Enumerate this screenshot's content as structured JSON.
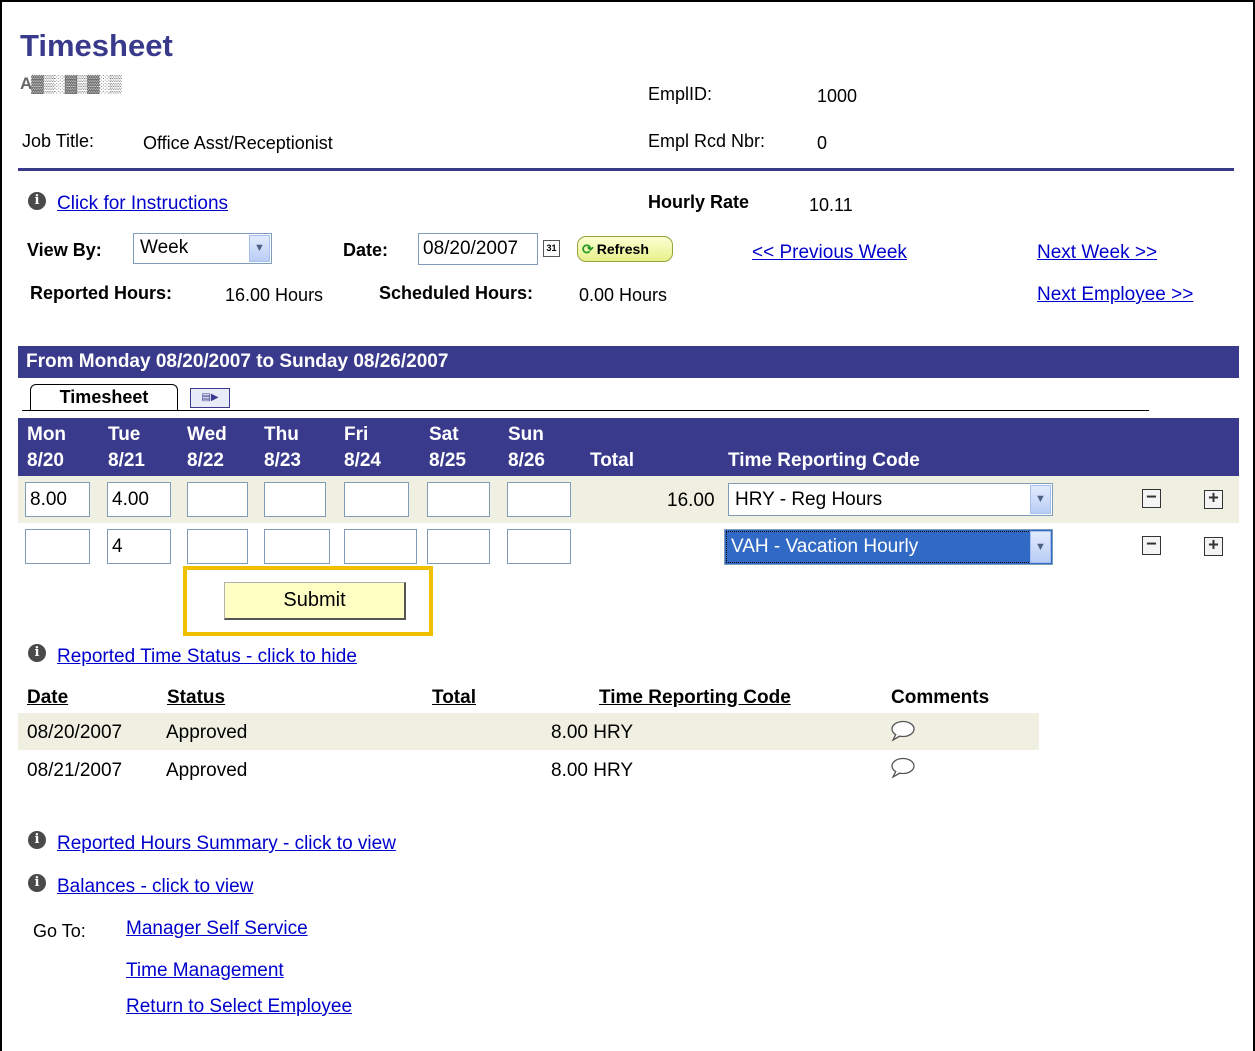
{
  "header": {
    "title": "Timesheet",
    "employee_name": "A▓▒░▓▒▓░▒",
    "emplid_label": "EmplID:",
    "emplid": "1000",
    "job_title_label": "Job Title:",
    "job_title": "Office Asst/Receptionist",
    "empl_rcd_label": "Empl Rcd Nbr:",
    "empl_rcd": "0"
  },
  "controls": {
    "instructions_link": "Click for Instructions",
    "hourly_rate_label": "Hourly Rate",
    "hourly_rate": "10.11",
    "view_by_label": "View By:",
    "view_by_value": "Week",
    "date_label": "Date:",
    "date_value": "08/20/2007",
    "calendar_glyph": "31",
    "refresh_label": "Refresh",
    "prev_week": "<< Previous Week",
    "next_week": "Next Week >>",
    "next_employee": "Next Employee >>",
    "reported_hours_label": "Reported Hours:",
    "reported_hours": "16.00 Hours",
    "scheduled_hours_label": "Scheduled Hours:",
    "scheduled_hours": "0.00 Hours"
  },
  "period": {
    "title": "From Monday 08/20/2007 to Sunday 08/26/2007",
    "tab_label": "Timesheet",
    "grid_icon": "▤▶"
  },
  "grid": {
    "days": [
      {
        "dow": "Mon",
        "date": "8/20"
      },
      {
        "dow": "Tue",
        "date": "8/21"
      },
      {
        "dow": "Wed",
        "date": "8/22"
      },
      {
        "dow": "Thu",
        "date": "8/23"
      },
      {
        "dow": "Fri",
        "date": "8/24"
      },
      {
        "dow": "Sat",
        "date": "8/25"
      },
      {
        "dow": "Sun",
        "date": "8/26"
      }
    ],
    "total_label": "Total",
    "trc_label": "Time Reporting Code",
    "rows": [
      {
        "values": [
          "8.00",
          "4.00",
          "",
          "",
          "",
          "",
          ""
        ],
        "total": "16.00",
        "trc": "HRY - Reg Hours"
      },
      {
        "values": [
          "",
          "4",
          "",
          "",
          "",
          "",
          ""
        ],
        "total": "",
        "trc": "VAH - Vacation Hourly"
      }
    ],
    "minus_glyph": "−",
    "plus_glyph": "+",
    "dropdown_glyph": "▼"
  },
  "submit_label": "Submit",
  "status": {
    "link": "Reported Time Status - click to hide",
    "col_date": "Date",
    "col_status": "Status",
    "col_total": "Total",
    "col_trc": "Time Reporting Code",
    "col_comments": "Comments",
    "rows": [
      {
        "date": "08/20/2007",
        "status": "Approved",
        "total_trc": "8.00 HRY"
      },
      {
        "date": "08/21/2007",
        "status": "Approved",
        "total_trc": "8.00 HRY"
      }
    ]
  },
  "summary_link": "Reported Hours Summary - click to view",
  "balances_link": "Balances - click to view",
  "goto": {
    "label": "Go To:",
    "links": [
      "Manager Self Service",
      "Time Management",
      "Return to Select Employee"
    ]
  },
  "info_glyph": "i",
  "colors": {
    "brand": "#3a3a8c",
    "link": "#0000cc",
    "row_highlight": "#efefe2",
    "submit_highlight": "#f0c000"
  }
}
